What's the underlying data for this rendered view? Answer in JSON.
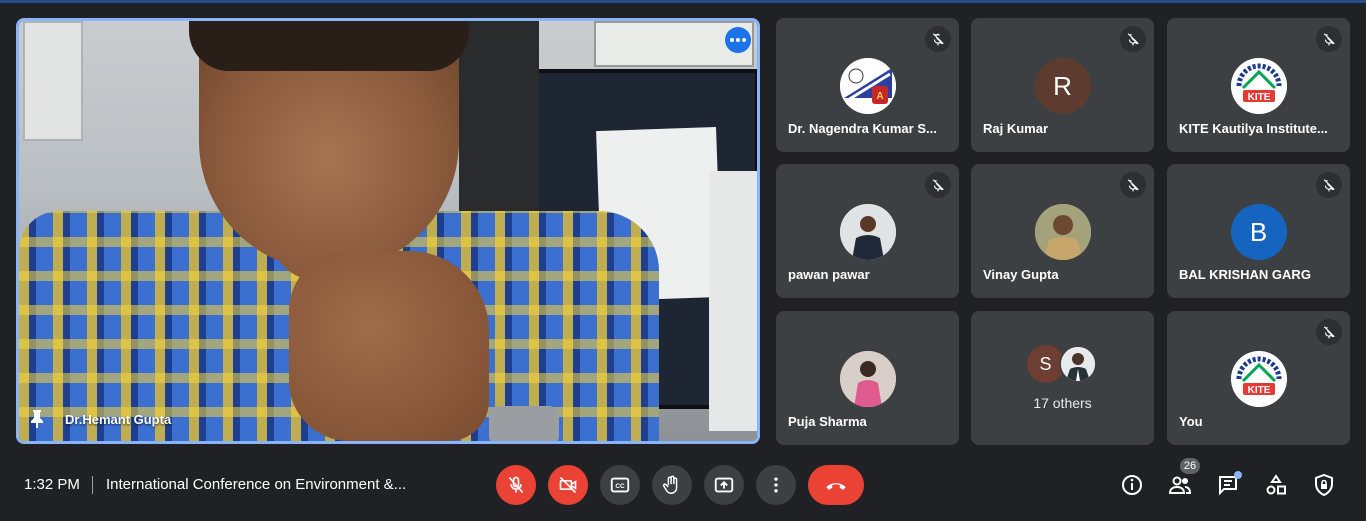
{
  "main_speaker": {
    "name": "Dr.Hemant Gupta"
  },
  "tiles": [
    {
      "name": "Dr. Nagendra Kumar S...",
      "avatar_type": "logo",
      "muted": true
    },
    {
      "name": "Raj Kumar",
      "avatar_letter": "R",
      "avatar_color": "#5d3b2e",
      "muted": true
    },
    {
      "name": "KITE Kautilya Institute...",
      "avatar_type": "logo",
      "avatar_text": "KITE",
      "muted": true
    },
    {
      "name": "pawan pawar",
      "avatar_type": "photo",
      "muted": true
    },
    {
      "name": "Vinay Gupta",
      "avatar_type": "photo",
      "muted": true
    },
    {
      "name": "BAL KRISHAN GARG",
      "avatar_letter": "B",
      "avatar_color": "#1565c0",
      "muted": true
    },
    {
      "name": "Puja Sharma",
      "avatar_type": "photo",
      "muted": false
    },
    {
      "others_letter": "S",
      "others_label": "17 others",
      "muted": false
    },
    {
      "name": "You",
      "avatar_type": "logo",
      "avatar_text": "KITE",
      "muted": true
    }
  ],
  "bottom_bar": {
    "time": "1:32 PM",
    "meeting_title": "International Conference on Environment &...",
    "participants_count": "26"
  },
  "colors": {
    "accent": "#8ab4f8",
    "danger": "#ea4335",
    "tile_bg": "#3c4043",
    "page_bg": "#202124"
  }
}
